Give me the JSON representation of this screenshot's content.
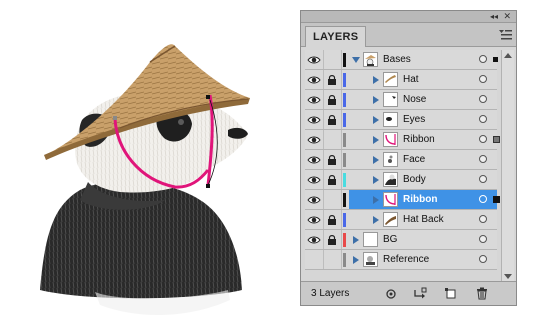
{
  "panel": {
    "tab_label": "LAYERS",
    "layer_count": "3 Layers",
    "selection_color": "#3f92e6"
  },
  "layers": [
    {
      "name": "Bases",
      "visible": true,
      "locked": false,
      "color": "#111111",
      "level": 0,
      "expanded": true,
      "selected": false,
      "thumb": "panda-thumb",
      "selection_indicator": true
    },
    {
      "name": "Hat",
      "visible": true,
      "locked": true,
      "color": "#4a68e8",
      "level": 1,
      "selected": false,
      "thumb": "hat-thumb"
    },
    {
      "name": "Nose",
      "visible": true,
      "locked": true,
      "color": "#4a68e8",
      "level": 1,
      "selected": false,
      "thumb": "nose-thumb"
    },
    {
      "name": "Eyes",
      "visible": true,
      "locked": true,
      "color": "#4a68e8",
      "level": 1,
      "selected": false,
      "thumb": "eyes-thumb"
    },
    {
      "name": "Ribbon",
      "visible": true,
      "locked": false,
      "color": "#8a8a8a",
      "level": 1,
      "selected": false,
      "thumb": "ribbon-thumb",
      "selection_indicator": true
    },
    {
      "name": "Face",
      "visible": true,
      "locked": true,
      "color": "#8a8a8a",
      "level": 1,
      "selected": false,
      "thumb": "face-thumb"
    },
    {
      "name": "Body",
      "visible": true,
      "locked": true,
      "color": "#49dce0",
      "level": 1,
      "selected": false,
      "thumb": "body-thumb"
    },
    {
      "name": "Ribbon",
      "visible": true,
      "locked": false,
      "color": "#111111",
      "level": 1,
      "selected": true,
      "thumb": "ribbon-thumb",
      "selection_indicator": true
    },
    {
      "name": "Hat Back",
      "visible": true,
      "locked": true,
      "color": "#4a68e8",
      "level": 1,
      "selected": false,
      "thumb": "hat-back-thumb"
    },
    {
      "name": "BG",
      "visible": true,
      "locked": true,
      "color": "#e84a4a",
      "level": 0,
      "selected": false,
      "thumb": "blank-thumb"
    },
    {
      "name": "Reference",
      "visible": false,
      "locked": false,
      "color": "#8a8a8a",
      "level": 0,
      "selected": false,
      "thumb": "reference-thumb"
    }
  ],
  "footer_buttons": [
    {
      "name": "make-clipping-mask-button",
      "icon": "clipping-mask-icon"
    },
    {
      "name": "create-sublayer-button",
      "icon": "new-sublayer-icon"
    },
    {
      "name": "create-layer-button",
      "icon": "new-layer-icon"
    },
    {
      "name": "delete-layer-button",
      "icon": "trash-icon"
    }
  ]
}
